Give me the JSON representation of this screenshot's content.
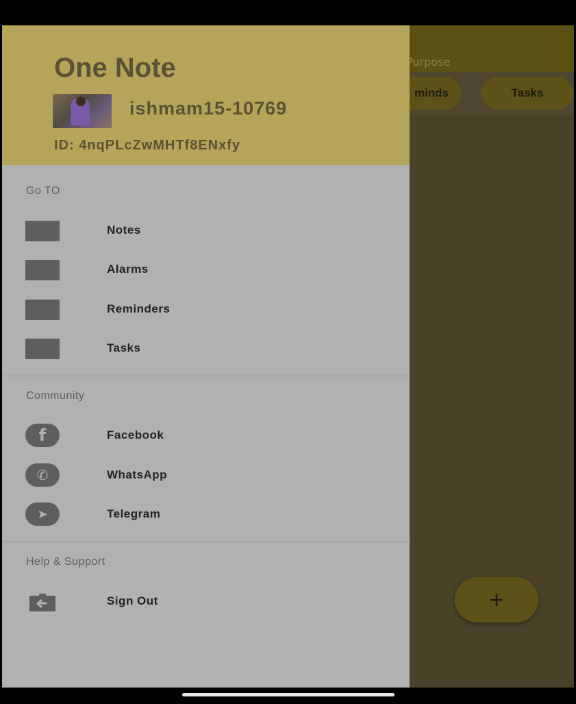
{
  "background_app": {
    "header_text": "Purpose",
    "tabs": [
      {
        "label": "minds"
      },
      {
        "label": "Tasks"
      }
    ],
    "fab_label": "+"
  },
  "drawer": {
    "header": {
      "app_title": "One Note",
      "username": "ishmam15-10769",
      "user_id": "ID:  4nqPLcZwMHTf8ENxfy"
    },
    "goto": {
      "title": "Go TO",
      "items": [
        {
          "label": "Notes"
        },
        {
          "label": "Alarms"
        },
        {
          "label": "Reminders"
        },
        {
          "label": "Tasks"
        }
      ]
    },
    "community": {
      "title": "Community",
      "items": [
        {
          "label": "Facebook",
          "icon": "facebook-icon",
          "glyph": "f"
        },
        {
          "label": "WhatsApp",
          "icon": "whatsapp-icon",
          "glyph": "✆"
        },
        {
          "label": "Telegram",
          "icon": "telegram-icon",
          "glyph": "➤"
        }
      ]
    },
    "help": {
      "title": "Help & Support",
      "items": [
        {
          "label": "Sign Out",
          "icon": "sign-out-icon"
        }
      ]
    }
  },
  "colors": {
    "header_bg": "#b4a55a",
    "drawer_bg": "#b1b1b1",
    "app_bg_dimmed": "#4a4228",
    "icon_gray": "#5e5e5e"
  }
}
